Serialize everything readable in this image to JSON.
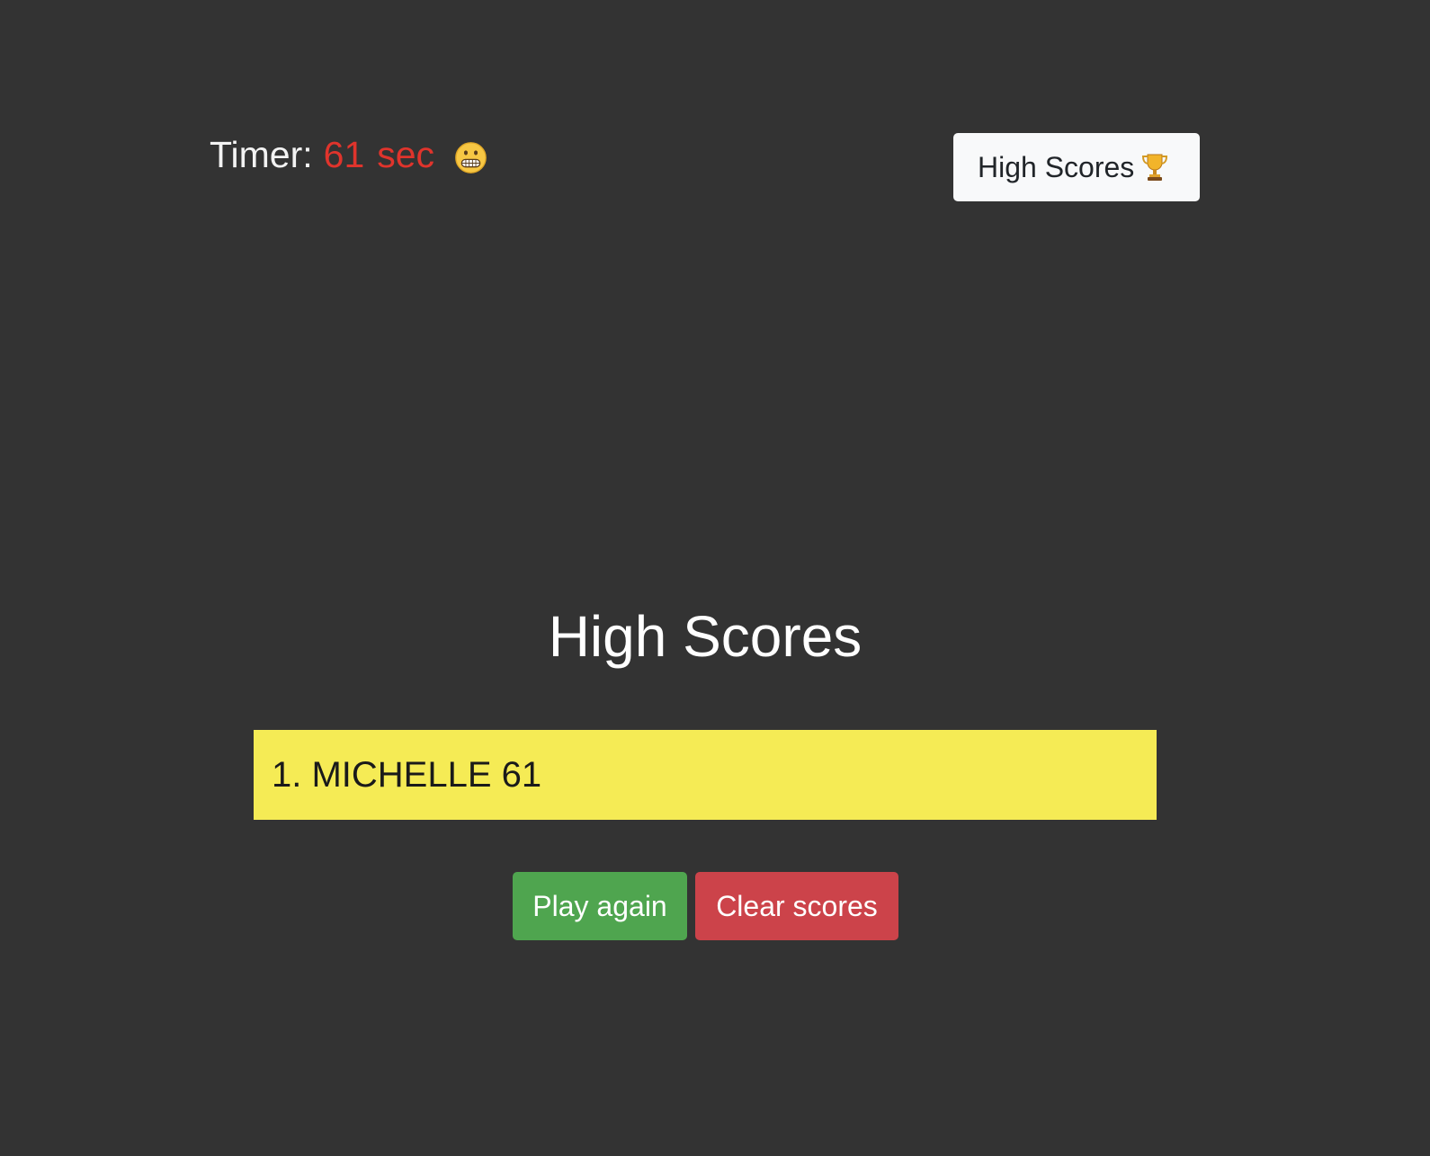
{
  "timer": {
    "label": "Timer:",
    "value": "61",
    "unit": "sec",
    "icon": "grimace-face-icon"
  },
  "header": {
    "high_scores_button": "High Scores",
    "high_scores_icon": "trophy-icon"
  },
  "main": {
    "title": "High Scores",
    "scores": [
      {
        "text": "1. MICHELLE 61"
      }
    ],
    "play_again_label": "Play again",
    "clear_scores_label": "Clear scores"
  },
  "colors": {
    "background": "#333333",
    "timer_value": "#e0342c",
    "score_row": "#f5eb55",
    "play_button": "#4fa54f",
    "clear_button": "#cc434a"
  }
}
